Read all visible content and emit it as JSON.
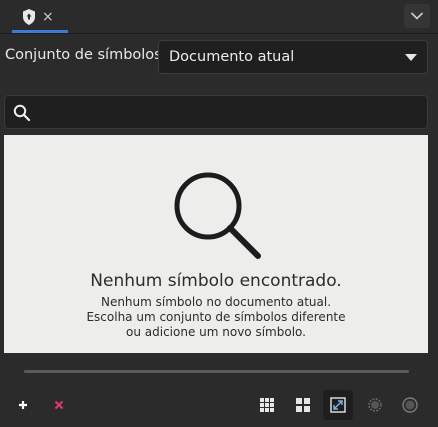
{
  "tab": {
    "close_glyph": "×"
  },
  "symbol_set": {
    "label": "Conjunto de símbolos:",
    "selected": "Documento atual"
  },
  "search": {
    "value": "",
    "placeholder": ""
  },
  "empty_state": {
    "title": "Nenhum símbolo encontrado.",
    "line1": "Nenhum símbolo no documento atual.",
    "line2": "Escolha um conjunto de símbolos diferente",
    "line3": "ou adicione um novo símbolo."
  },
  "toolbar": {
    "add_icon": "plus-icon",
    "remove_icon": "remove-icon",
    "add_color": "#ffffff",
    "remove_color": "#e0356f"
  },
  "colors": {
    "tab_accent": "#3d7ad6",
    "panel_bg": "#2b2b2b",
    "results_bg": "#ededeb"
  }
}
